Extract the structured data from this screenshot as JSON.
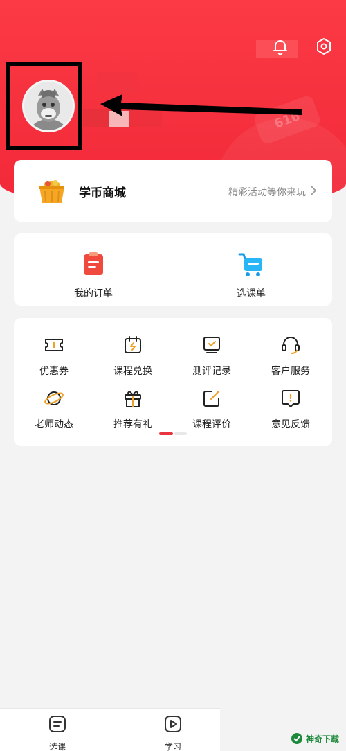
{
  "header": {
    "bell_icon": "bell-icon",
    "settings_icon": "settings-icon",
    "brand_color": "#f22838",
    "deco_tag": "616"
  },
  "mall": {
    "title": "学币商城",
    "subtitle": "精彩活动等你来玩",
    "icon": "basket-icon"
  },
  "orders": {
    "items": [
      {
        "label": "我的订单",
        "icon": "order-icon"
      },
      {
        "label": "选课单",
        "icon": "cart-icon"
      }
    ]
  },
  "services": {
    "items": [
      {
        "label": "优惠券",
        "icon": "coupon-icon"
      },
      {
        "label": "课程兑换",
        "icon": "calendar-exchange-icon"
      },
      {
        "label": "测评记录",
        "icon": "assessment-icon"
      },
      {
        "label": "客户服务",
        "icon": "headset-icon"
      },
      {
        "label": "老师动态",
        "icon": "planet-icon"
      },
      {
        "label": "推荐有礼",
        "icon": "gift-icon"
      },
      {
        "label": "课程评价",
        "icon": "edit-icon"
      },
      {
        "label": "意见反馈",
        "icon": "feedback-icon"
      }
    ],
    "pager": {
      "page": 1,
      "pages": 2
    }
  },
  "bottom_nav": {
    "items": [
      {
        "label": "选课",
        "icon": "list-icon"
      },
      {
        "label": "学习",
        "icon": "play-icon"
      }
    ]
  },
  "watermark": {
    "text": "神奇下载"
  }
}
